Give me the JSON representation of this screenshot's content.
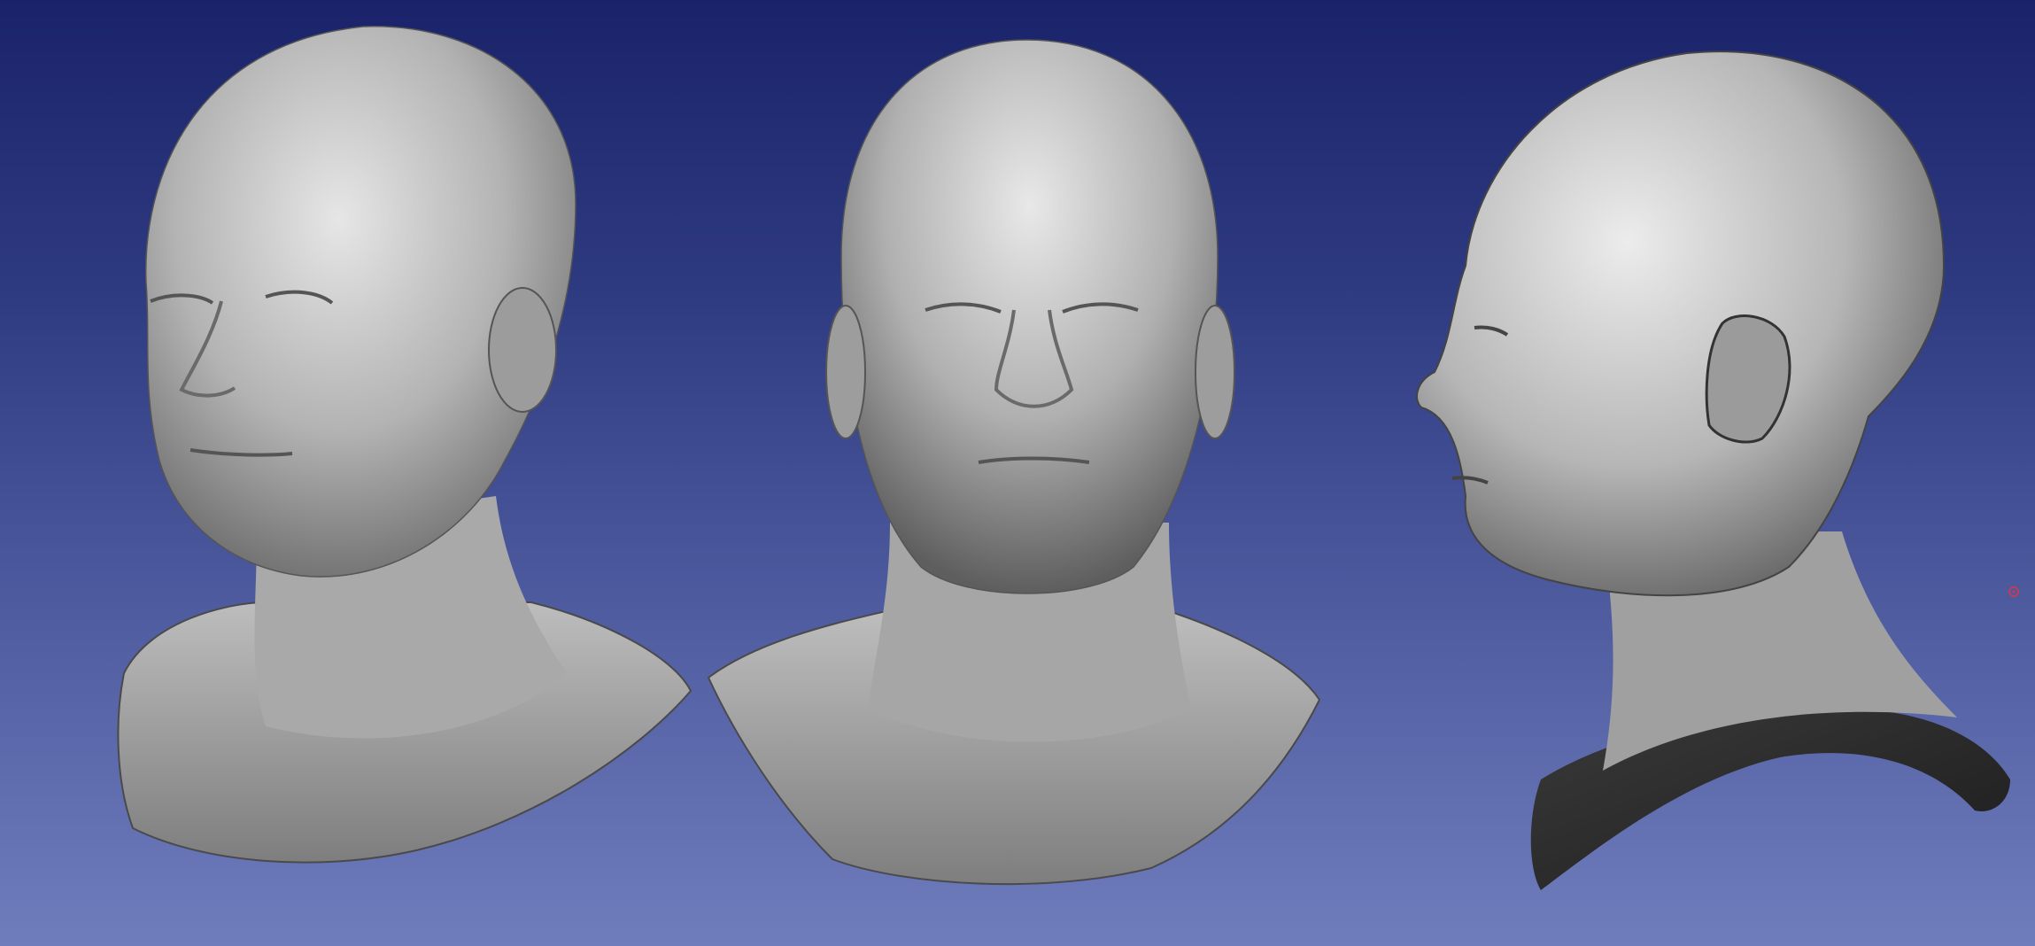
{
  "window": {
    "title": ""
  },
  "viewport": {
    "background_top": "#1a236a",
    "background_bottom": "#6f7dbd",
    "mesh_color": "#b8b8b8"
  },
  "meshes": [
    {
      "name": "head-three-quarter-view"
    },
    {
      "name": "head-front-view"
    },
    {
      "name": "head-side-view"
    }
  ],
  "marker": {
    "color": "#c23b5a",
    "icon": "trackball-center-icon"
  }
}
